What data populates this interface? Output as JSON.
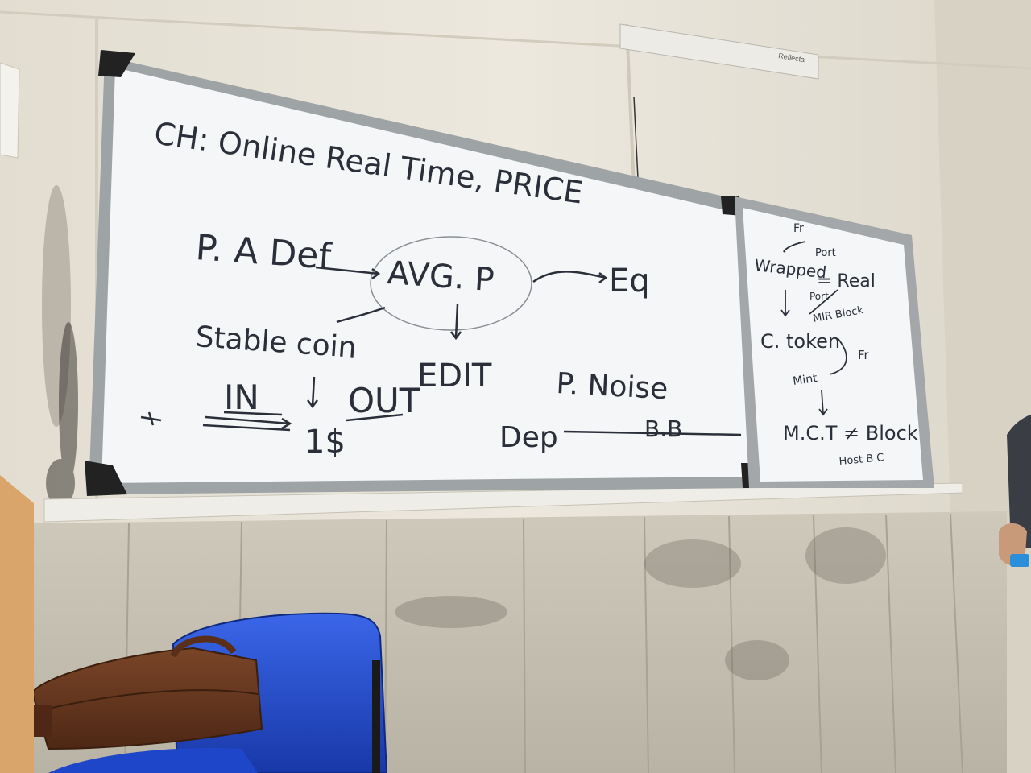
{
  "projector_brand": "Reflecta",
  "main_board": {
    "lines": [
      "CH: Online Real Time, PRICE",
      "P. A Def",
      "AVG. P",
      "Eq",
      "Stable coin",
      "EDIT",
      "P. Noise",
      "IN",
      "OUT",
      "1$",
      "Dep",
      "B.B"
    ]
  },
  "side_board": {
    "lines": [
      "Fr",
      "Port",
      "Wrapped",
      "= Real",
      "Port",
      "MIR Block",
      "C. token",
      "Fr",
      "Mint",
      "M.C.T ≠ Block",
      "Host B C"
    ]
  },
  "colors": {
    "wall": "#e9e5db",
    "board": "#f4f6f7",
    "frame": "#9ea3a6",
    "marker": "#2a2f3a",
    "chair": "#1f4fd1",
    "bag": "#6b3a22",
    "tile": "#cfcabe"
  }
}
